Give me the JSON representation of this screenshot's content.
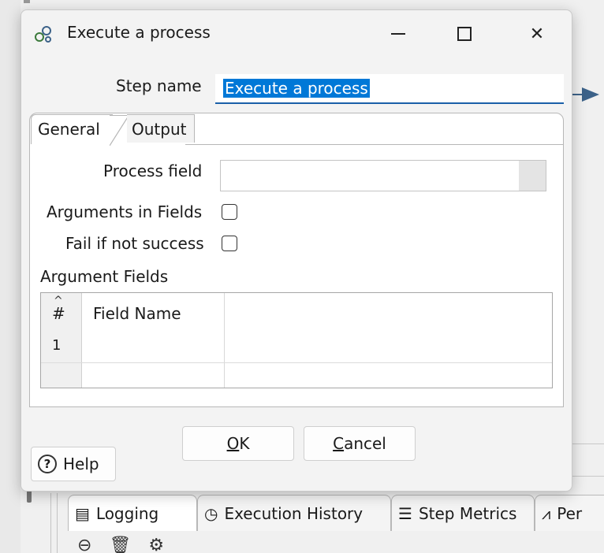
{
  "dialog": {
    "title": "Execute a process",
    "step_name_label": "Step name",
    "step_name_value": "Execute a process",
    "tabs": [
      {
        "label": "General",
        "active": true
      },
      {
        "label": "Output",
        "active": false
      }
    ],
    "general": {
      "process_field_label": "Process field",
      "process_field_value": "",
      "arguments_in_fields_label": "Arguments in Fields",
      "arguments_in_fields_checked": false,
      "fail_if_not_success_label": "Fail if not success",
      "fail_if_not_success_checked": false,
      "argument_fields_label": "Argument Fields",
      "grid": {
        "columns": [
          "#",
          "Field Name"
        ],
        "rows": [
          [
            "1",
            ""
          ]
        ]
      }
    },
    "buttons": {
      "ok_accel": "O",
      "ok_rest": "K",
      "cancel_accel": "C",
      "cancel_rest": "ancel",
      "help": "Help"
    },
    "window_controls": {
      "close_glyph": "✕"
    }
  },
  "background": {
    "bottom_tabs": [
      {
        "label": "Logging",
        "icon": "log-icon"
      },
      {
        "label": "Execution History",
        "icon": "clock-icon"
      },
      {
        "label": "Step Metrics",
        "icon": "list-numbered-icon"
      },
      {
        "label": "Per",
        "icon": "chart-icon"
      }
    ],
    "toolbar_icons": [
      "minus-circle-icon",
      "trash-icon",
      "gear-icon"
    ]
  },
  "colors": {
    "accent": "#1a5fa8",
    "selection": "#0078d7",
    "hop_arrow": "#3c6289"
  }
}
